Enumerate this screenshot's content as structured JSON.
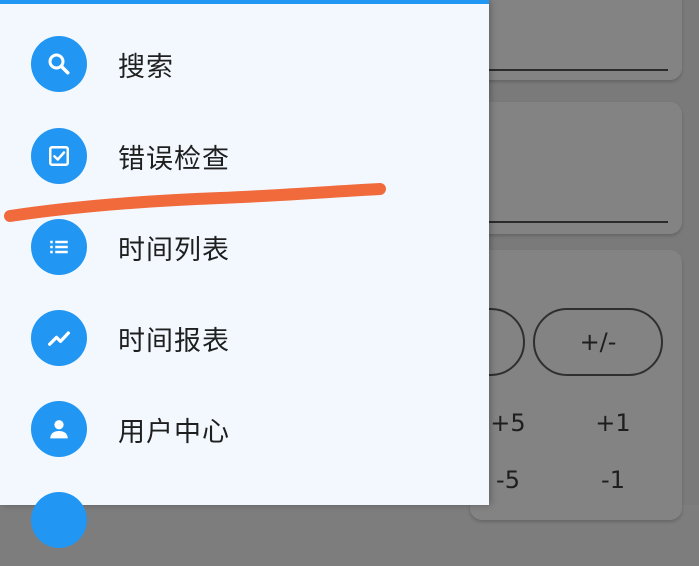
{
  "drawer": {
    "items": [
      {
        "label": "搜索",
        "icon": "search-icon"
      },
      {
        "label": "错误检查",
        "icon": "check-box-icon"
      },
      {
        "label": "时间列表",
        "icon": "list-icon"
      },
      {
        "label": "时间报表",
        "icon": "trend-chart-icon"
      },
      {
        "label": "用户中心",
        "icon": "user-icon"
      },
      {
        "label": "",
        "icon": "partial-icon"
      }
    ]
  },
  "background": {
    "sign_button_label": "+/-",
    "steps": {
      "plus_five": "+5",
      "plus_one": "+1",
      "minus_five": "-5",
      "minus_one": "-1"
    }
  },
  "colors": {
    "accent": "#2196f3",
    "drawer_bg": "#f2f8fe",
    "annotation": "#f06a3b",
    "scrim": "#7a7a7a"
  }
}
